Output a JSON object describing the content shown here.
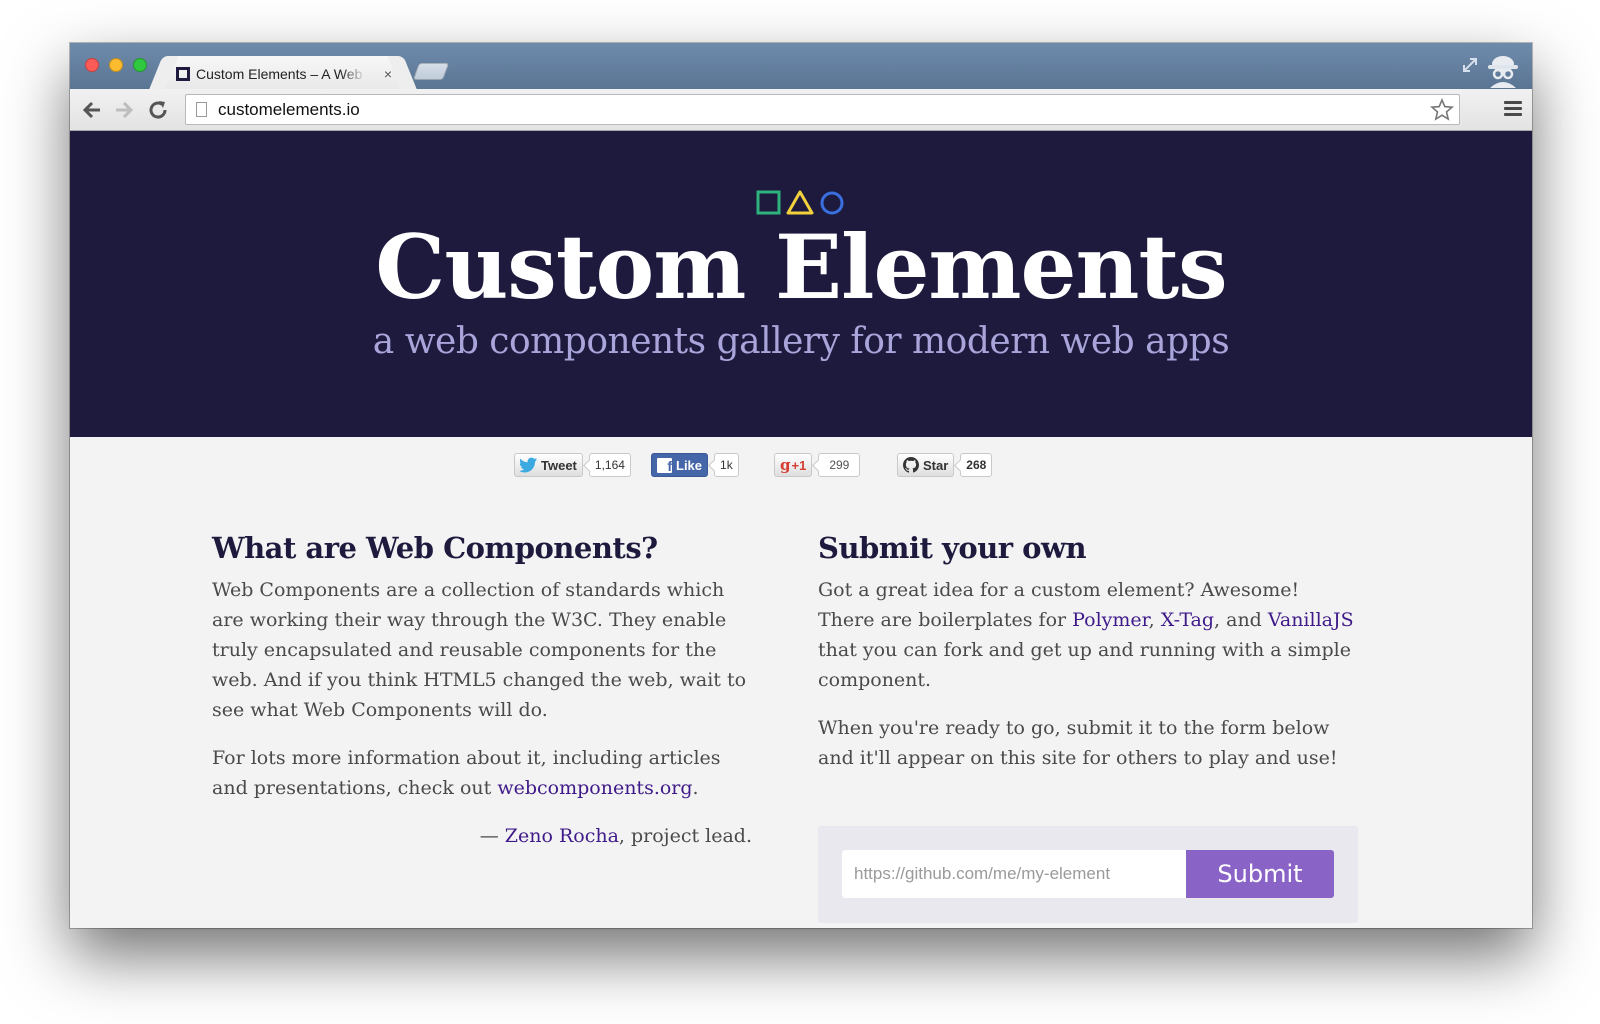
{
  "browser": {
    "tab_title": "Custom Elements – A Web Components Gallery",
    "tab_close": "×",
    "url": "customelements.io"
  },
  "hero": {
    "title": "Custom Elements",
    "subtitle": "a web components gallery for modern web apps",
    "logo_colors": [
      "#2db37b",
      "#f2d13c",
      "#3a6fe0"
    ]
  },
  "social": {
    "tweet": {
      "label": "Tweet",
      "count": "1,164"
    },
    "like": {
      "label": "Like",
      "count": "1k"
    },
    "gplus": {
      "label": "+1",
      "count": "299"
    },
    "star": {
      "label": "Star",
      "count": "268"
    }
  },
  "about": {
    "heading": "What are Web Components?",
    "paragraph1": "Web Components are a collection of standards which are working their way through the W3C. They enable truly encapsulated and reusable components for the web. And if you think HTML5 changed the web, wait to see what Web Components will do.",
    "paragraph2_before": "For lots more information about it, including articles and presentations, check out ",
    "paragraph2_link": "webcomponents.org",
    "paragraph2_after": ".",
    "signature_dash": "— ",
    "signature_link": "Zeno Rocha",
    "signature_after": ", project lead."
  },
  "submit": {
    "heading": "Submit your own",
    "p1_before": "Got a great idea for a custom element? Awesome! There are boilerplates for ",
    "link_polymer": "Polymer",
    "sep1": ", ",
    "link_xtag": "X-Tag",
    "sep2": ", and ",
    "link_vanilla": "VanillaJS",
    "p1_after": " that you can fork and get up and running with a simple component.",
    "paragraph2": "When you're ready to go, submit it to the form below and it'll appear on this site for others to play and use!",
    "input_placeholder": "https://github.com/me/my-element",
    "button_label": "Submit"
  },
  "colors": {
    "hero_bg": "#1d1a3e",
    "link": "#3f1a8a",
    "submit_button": "#8a63c7"
  }
}
